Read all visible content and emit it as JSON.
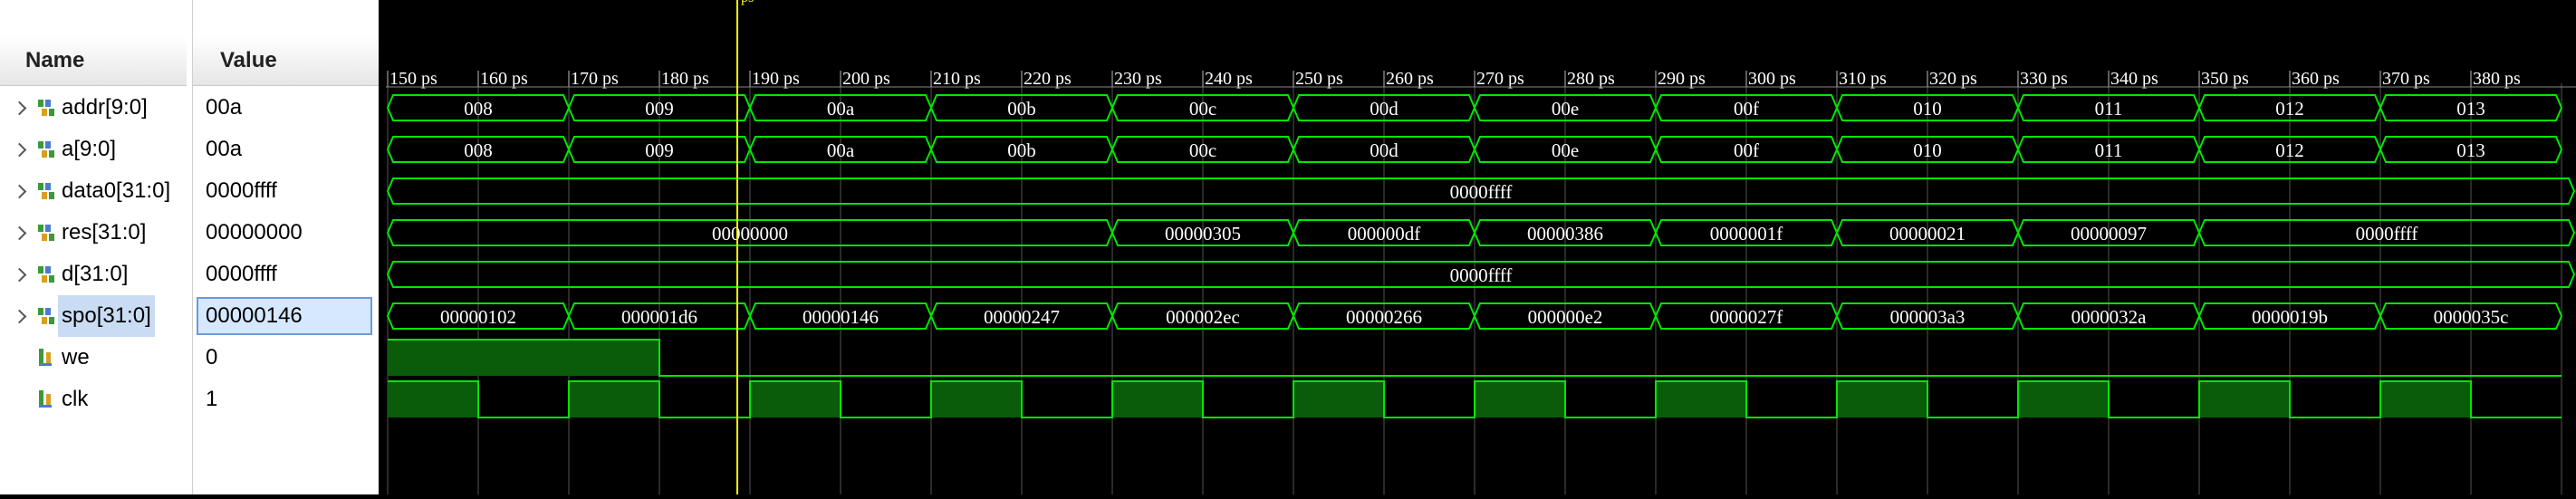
{
  "headers": {
    "name": "Name",
    "value": "Value"
  },
  "cursor_label": "ps",
  "signals": [
    {
      "id": "addr",
      "name": "addr[9:0]",
      "value": "00a",
      "icon": "bus-icon",
      "expandable": true
    },
    {
      "id": "a",
      "name": "a[9:0]",
      "value": "00a",
      "icon": "bus-icon",
      "expandable": true
    },
    {
      "id": "data0",
      "name": "data0[31:0]",
      "value": "0000ffff",
      "icon": "bus-icon",
      "expandable": true
    },
    {
      "id": "res",
      "name": "res[31:0]",
      "value": "00000000",
      "icon": "bus-icon",
      "expandable": true
    },
    {
      "id": "d",
      "name": "d[31:0]",
      "value": "0000ffff",
      "icon": "bus-icon",
      "expandable": true
    },
    {
      "id": "spo",
      "name": "spo[31:0]",
      "value": "00000146",
      "icon": "bus-icon",
      "expandable": true,
      "selected": true
    },
    {
      "id": "we",
      "name": "we",
      "value": "0",
      "icon": "bit-icon",
      "expandable": false
    },
    {
      "id": "clk",
      "name": "clk",
      "value": "1",
      "icon": "bit-icon",
      "expandable": false
    }
  ],
  "time_axis": {
    "labels": [
      "150 ps",
      "160 ps",
      "170 ps",
      "180 ps",
      "190 ps",
      "200 ps",
      "210 ps",
      "220 ps",
      "230 ps",
      "240 ps",
      "250 ps",
      "260 ps",
      "270 ps",
      "280 ps",
      "290 ps",
      "300 ps",
      "310 ps",
      "320 ps",
      "330 ps",
      "340 ps",
      "350 ps",
      "360 ps",
      "370 ps",
      "380 ps"
    ]
  },
  "waves": {
    "addr": [
      "008",
      "009",
      "00a",
      "00b",
      "00c",
      "00d",
      "00e",
      "00f",
      "010",
      "011",
      "012",
      "013"
    ],
    "a": [
      "008",
      "009",
      "00a",
      "00b",
      "00c",
      "00d",
      "00e",
      "00f",
      "010",
      "011",
      "012",
      "013"
    ],
    "data0": [
      "0000ffff"
    ],
    "res": [
      "00000000",
      "00000305",
      "000000df",
      "00000386",
      "0000001f",
      "00000021",
      "00000097",
      "0000ffff"
    ],
    "d": [
      "0000ffff"
    ],
    "spo": [
      "00000102",
      "000001d6",
      "00000146",
      "00000247",
      "000002ec",
      "00000266",
      "000000e2",
      "0000027f",
      "000003a3",
      "0000032a",
      "0000019b",
      "0000035c"
    ],
    "we": [
      1,
      1,
      1,
      0,
      0,
      0,
      0,
      0,
      0,
      0,
      0,
      0,
      0,
      0,
      0,
      0,
      0,
      0,
      0,
      0,
      0,
      0,
      0,
      0
    ],
    "clk": [
      1,
      0,
      1,
      0,
      1,
      0,
      1,
      0,
      1,
      0,
      1,
      0,
      1,
      0,
      1,
      0,
      1,
      0,
      1,
      0,
      1,
      0,
      1,
      0
    ]
  },
  "colors": {
    "wave": "#00e600",
    "fill": "#0a5c0a",
    "grid": "#555555",
    "cursor": "#ffff00",
    "background": "#000000"
  }
}
